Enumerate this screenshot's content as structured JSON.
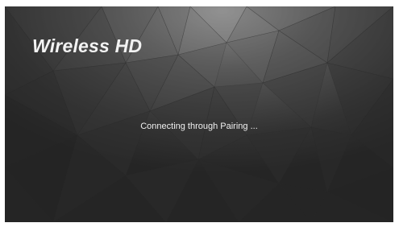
{
  "screen": {
    "title": "Wireless HD",
    "status_message": "Connecting through Pairing ..."
  },
  "colors": {
    "background_base": "#2b2b2b",
    "highlight": "#8a8a8a",
    "text": "#f2f2f2"
  }
}
